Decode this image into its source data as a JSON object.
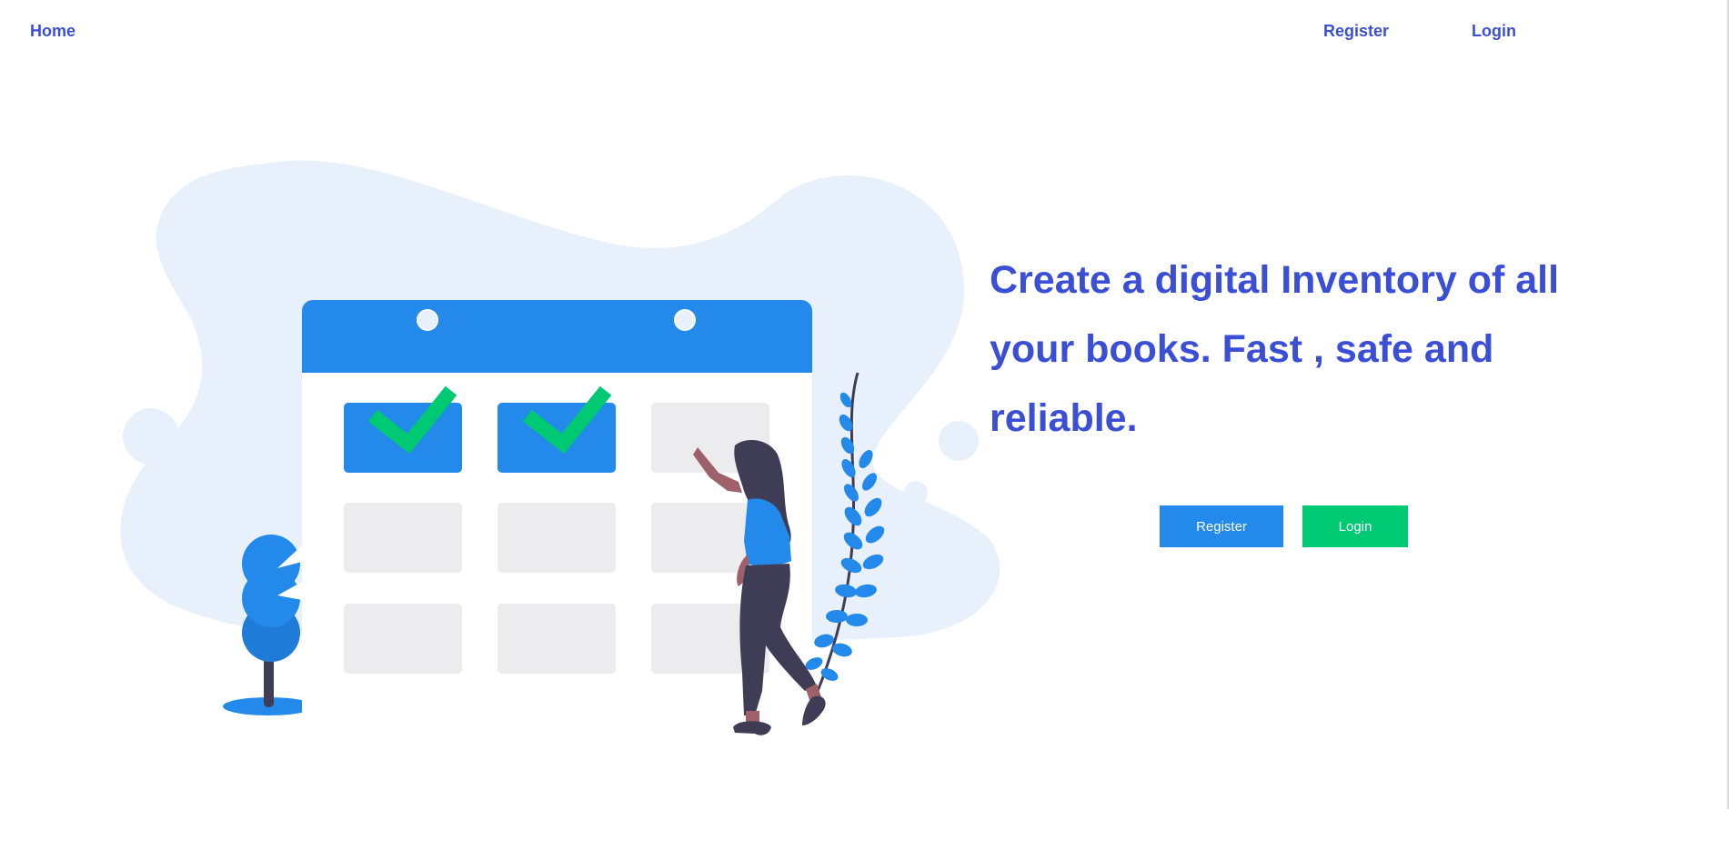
{
  "nav": {
    "home_label": "Home",
    "register_label": "Register",
    "login_label": "Login"
  },
  "hero": {
    "headline": "Create a digital Inventory of all your books. Fast , safe and reliable.",
    "register_button": "Register",
    "login_button": "Login"
  },
  "illustration": {
    "subject": "calendar-with-checkmarks-and-woman",
    "checked_cells": 2,
    "total_cells": 9
  },
  "colors": {
    "accent_text": "#3a4fd6",
    "primary_blue": "#2389ea",
    "success_green": "#00c974",
    "blob_bg": "#e8f1fb"
  }
}
